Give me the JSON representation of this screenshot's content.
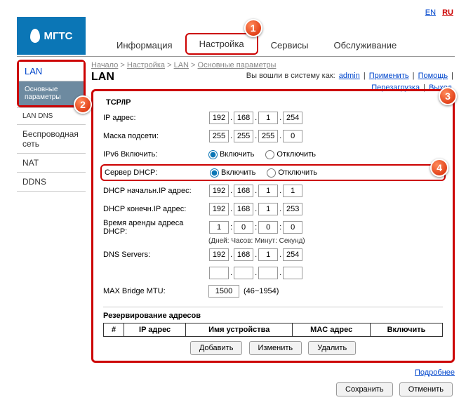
{
  "lang": {
    "en": "EN",
    "ru": "RU"
  },
  "logo": "МГТС",
  "tabs": {
    "info": "Информация",
    "setup": "Настройка",
    "services": "Сервисы",
    "maint": "Обслуживание"
  },
  "callouts": {
    "c1": "1",
    "c2": "2",
    "c3": "3",
    "c4": "4"
  },
  "sidebar": {
    "lan": "LAN",
    "basic": "Основные параметры",
    "landns": "LAN DNS",
    "wireless": "Беспроводная сеть",
    "nat": "NAT",
    "ddns": "DDNS"
  },
  "crumbs": {
    "start": "Начало",
    "setup": "Настройка",
    "lan": "LAN",
    "basic": "Основные параметры"
  },
  "status": {
    "prefix": "Вы вошли в систему как:",
    "user": "admin",
    "apply": "Применить",
    "help": "Помощь",
    "reboot": "Перезагрузка",
    "logout": "Выход"
  },
  "title": "LAN",
  "tcpip": {
    "legend": "TCP/IP",
    "ip_label": "IP адрес:",
    "ip": [
      "192",
      "168",
      "1",
      "254"
    ],
    "mask_label": "Маска подсети:",
    "mask": [
      "255",
      "255",
      "255",
      "0"
    ],
    "ipv6_label": "IPv6 Включить:",
    "on": "Включить",
    "off": "Отключить",
    "dhcp_label": "Сервер DHCP:",
    "dhcp_start_label": "DHCP начальн.IP адрес:",
    "dhcp_start": [
      "192",
      "168",
      "1",
      "1"
    ],
    "dhcp_end_label": "DHCP конечн.IP адрес:",
    "dhcp_end": [
      "192",
      "168",
      "1",
      "253"
    ],
    "lease_label": "Время аренды адреса DHCP:",
    "lease": [
      "1",
      "0",
      "0",
      "0"
    ],
    "lease_note": "(Дней: Часов: Минут: Секунд)",
    "dns_label": "DNS Servers:",
    "dns": [
      "192",
      "168",
      "1",
      "254"
    ],
    "mtu_label": "MAX Bridge MTU:",
    "mtu": "1500",
    "mtu_range": "(46~1954)"
  },
  "reserve": {
    "legend": "Резервирование адресов",
    "cols": {
      "num": "#",
      "ip": "IP адрес",
      "name": "Имя устройства",
      "mac": "MAC адрес",
      "en": "Включить"
    },
    "add": "Добавить",
    "edit": "Изменить",
    "del": "Удалить"
  },
  "more": "Подробнее",
  "save": "Сохранить",
  "cancel": "Отменить"
}
